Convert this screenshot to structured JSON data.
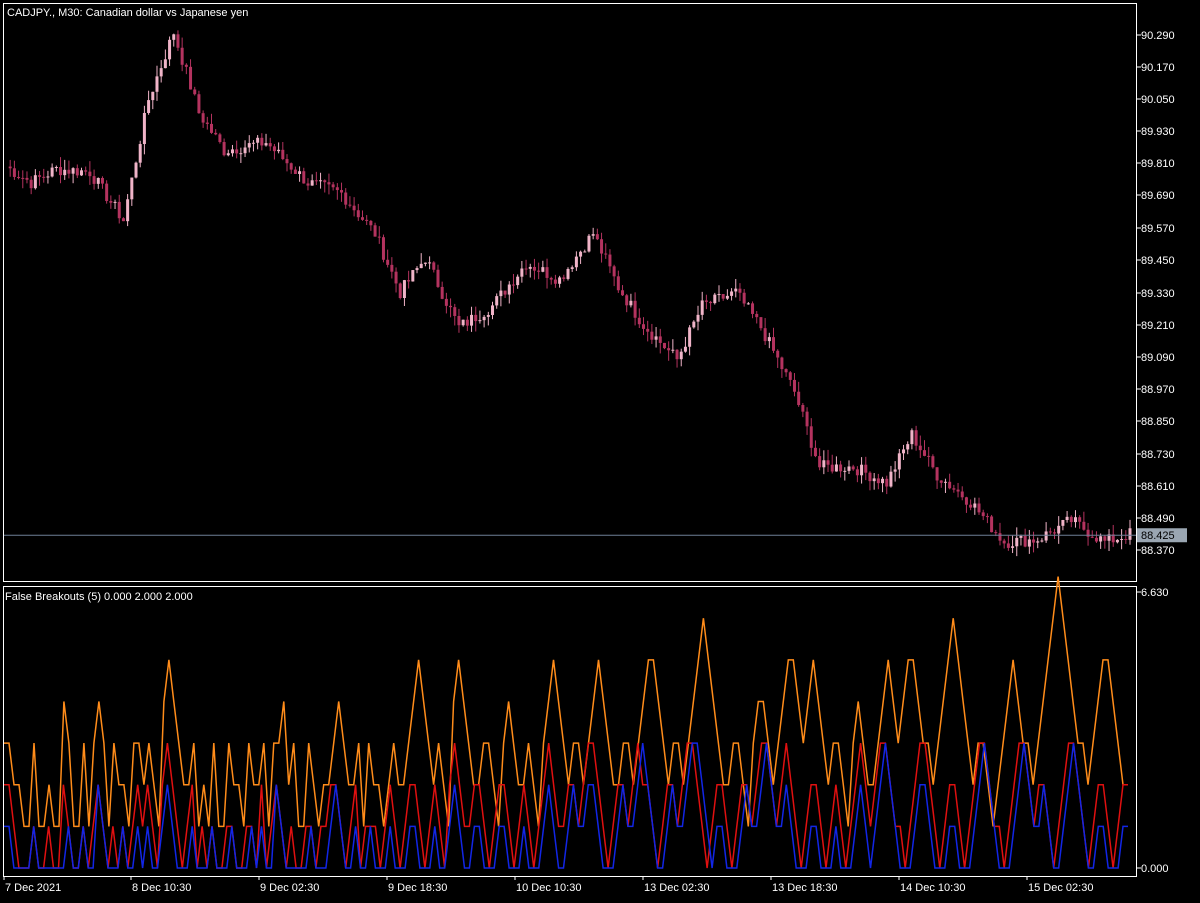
{
  "colors": {
    "background": "#000000",
    "axis": "#ffffff",
    "text": "#ffffff",
    "bear_candle": "#b4335f",
    "bull_candle": "#f0b4c8",
    "current_line": "#6e7f95",
    "line_orange": "#ff8c1a",
    "line_red": "#e01010",
    "line_blue": "#1226e6"
  },
  "price_panel": {
    "title": "CADJPY., M30:  Canadian dollar vs Japanese yen",
    "current_price": "88.425",
    "y_ticks": [
      "90.290",
      "90.170",
      "90.050",
      "89.930",
      "89.810",
      "89.690",
      "89.570",
      "89.450",
      "89.330",
      "89.210",
      "89.090",
      "88.970",
      "88.850",
      "88.730",
      "88.610",
      "88.490",
      "88.370"
    ]
  },
  "indicator_panel": {
    "title": "False Breakouts (5) 0.000 2.000 2.000",
    "y_ticks": [
      "6.630",
      "0.000"
    ]
  },
  "x_ticks": [
    "7 Dec 2021",
    "8 Dec 10:30",
    "9 Dec 02:30",
    "9 Dec 18:30",
    "10 Dec 10:30",
    "13 Dec 02:30",
    "13 Dec 18:30",
    "14 Dec 10:30",
    "15 Dec 02:30"
  ],
  "chart_data": [
    {
      "type": "candlestick",
      "title": "CADJPY., M30:  Canadian dollar vs Japanese yen",
      "ylim": [
        88.33,
        90.35
      ],
      "current_price": 88.425,
      "close_path": [
        [
          0,
          89.8
        ],
        [
          6,
          89.74
        ],
        [
          12,
          89.79
        ],
        [
          20,
          89.78
        ],
        [
          28,
          89.6
        ],
        [
          34,
          90.05
        ],
        [
          40,
          90.3
        ],
        [
          46,
          90.0
        ],
        [
          52,
          89.86
        ],
        [
          62,
          89.89
        ],
        [
          72,
          89.74
        ],
        [
          80,
          89.7
        ],
        [
          88,
          89.55
        ],
        [
          94,
          89.33
        ],
        [
          100,
          89.46
        ],
        [
          108,
          89.2
        ],
        [
          116,
          89.28
        ],
        [
          124,
          89.44
        ],
        [
          132,
          89.38
        ],
        [
          140,
          89.55
        ],
        [
          146,
          89.35
        ],
        [
          152,
          89.21
        ],
        [
          160,
          89.08
        ],
        [
          166,
          89.28
        ],
        [
          174,
          89.33
        ],
        [
          180,
          89.2
        ],
        [
          188,
          88.96
        ],
        [
          194,
          88.68
        ],
        [
          202,
          88.68
        ],
        [
          210,
          88.62
        ],
        [
          216,
          88.8
        ],
        [
          222,
          88.65
        ],
        [
          230,
          88.55
        ],
        [
          238,
          88.4
        ],
        [
          246,
          88.41
        ],
        [
          254,
          88.48
        ],
        [
          262,
          88.4
        ],
        [
          268,
          88.43
        ]
      ]
    },
    {
      "type": "line",
      "title": "False Breakouts (5) 0.000 2.000 2.000",
      "ylim": [
        0,
        6.63
      ],
      "orange_levels": [
        3,
        3,
        2,
        2,
        1,
        1,
        3,
        1,
        1,
        2,
        1,
        1,
        4,
        3,
        1,
        1,
        3,
        1,
        3,
        4,
        3,
        1,
        3,
        2,
        2,
        1,
        3,
        3,
        2,
        3,
        2,
        1,
        4,
        5,
        4,
        3,
        2,
        2,
        3,
        1,
        2,
        1,
        3,
        1,
        1,
        3,
        2,
        2,
        1,
        3,
        2,
        2,
        3,
        1,
        3,
        3,
        4,
        2,
        3,
        1,
        1,
        3,
        2,
        1,
        2,
        2,
        3,
        4,
        3,
        2,
        2,
        3,
        1,
        3,
        2,
        2,
        1,
        2,
        3,
        2,
        2,
        3,
        4,
        5,
        4,
        3,
        2,
        3,
        2,
        1,
        4,
        5,
        4,
        3,
        2,
        2,
        3,
        3,
        2,
        1,
        3,
        4,
        3,
        2,
        2,
        3,
        2,
        1,
        3,
        4,
        5,
        4,
        3,
        2,
        3,
        3,
        2,
        3,
        4,
        5,
        4,
        3,
        2,
        2,
        3,
        3,
        2,
        3,
        4,
        5,
        5,
        4,
        3,
        2,
        3,
        3,
        2,
        3,
        4,
        5,
        6,
        5,
        4,
        3,
        2,
        2,
        3,
        3,
        2,
        1,
        3,
        4,
        4,
        3,
        2,
        3,
        4,
        5,
        5,
        4,
        3,
        4,
        5,
        4,
        3,
        2,
        3,
        3,
        2,
        1,
        3,
        4,
        3,
        2,
        2,
        3,
        4,
        5,
        4,
        3,
        4,
        5,
        5,
        4,
        3,
        3,
        2,
        3,
        4,
        5,
        6,
        5,
        4,
        3,
        2,
        3,
        3,
        2,
        1,
        2,
        3,
        4,
        5,
        4,
        3,
        3,
        2,
        3,
        4,
        5,
        6,
        7,
        6,
        5,
        4,
        3,
        3,
        2,
        3,
        4,
        5,
        5,
        4,
        3,
        2,
        2
      ],
      "red_levels": [
        2,
        2,
        1,
        0,
        0,
        0,
        1,
        0,
        0,
        1,
        0,
        0,
        2,
        1,
        0,
        0,
        1,
        0,
        1,
        2,
        1,
        0,
        1,
        0,
        1,
        0,
        1,
        2,
        1,
        2,
        1,
        0,
        2,
        3,
        2,
        1,
        0,
        1,
        2,
        0,
        1,
        0,
        1,
        0,
        0,
        1,
        1,
        0,
        0,
        1,
        1,
        0,
        2,
        0,
        1,
        2,
        1,
        0,
        1,
        0,
        0,
        1,
        1,
        0,
        1,
        1,
        2,
        2,
        1,
        0,
        1,
        2,
        0,
        1,
        1,
        1,
        0,
        1,
        2,
        1,
        0,
        1,
        2,
        2,
        1,
        0,
        1,
        2,
        1,
        0,
        2,
        3,
        2,
        1,
        1,
        2,
        2,
        1,
        0,
        1,
        2,
        2,
        1,
        0,
        1,
        2,
        1,
        0,
        1,
        2,
        3,
        2,
        1,
        1,
        2,
        2,
        1,
        2,
        3,
        3,
        2,
        1,
        0,
        1,
        2,
        2,
        1,
        2,
        3,
        2,
        2,
        1,
        0,
        1,
        2,
        2,
        1,
        2,
        3,
        3,
        2,
        1,
        0,
        1,
        2,
        2,
        1,
        0,
        1,
        2,
        2,
        1,
        2,
        3,
        3,
        2,
        1,
        2,
        3,
        2,
        1,
        0,
        1,
        2,
        2,
        1,
        0,
        1,
        2,
        1,
        0,
        1,
        2,
        3,
        2,
        1,
        2,
        3,
        3,
        2,
        1,
        1,
        0,
        1,
        2,
        3,
        3,
        2,
        1,
        0,
        1,
        2,
        2,
        1,
        0,
        1,
        2,
        3,
        3,
        2,
        1,
        1,
        0,
        1,
        2,
        3,
        3,
        2,
        1,
        2,
        2,
        1,
        0,
        1,
        2,
        3,
        3,
        2,
        1,
        0,
        1,
        2,
        2,
        1,
        0,
        1,
        2,
        2
      ],
      "blue_levels": [
        1,
        1,
        0,
        0,
        0,
        0,
        1,
        0,
        0,
        0,
        0,
        0,
        0,
        1,
        0,
        0,
        1,
        0,
        0,
        2,
        1,
        0,
        0,
        0,
        1,
        0,
        0,
        1,
        0,
        1,
        0,
        0,
        1,
        2,
        1,
        0,
        0,
        0,
        1,
        0,
        0,
        0,
        1,
        0,
        0,
        0,
        1,
        0,
        0,
        0,
        1,
        0,
        1,
        0,
        0,
        2,
        1,
        0,
        0,
        0,
        0,
        0,
        1,
        0,
        0,
        0,
        1,
        2,
        1,
        0,
        0,
        1,
        0,
        0,
        1,
        0,
        0,
        0,
        1,
        0,
        0,
        0,
        1,
        1,
        0,
        0,
        0,
        1,
        0,
        0,
        1,
        2,
        1,
        0,
        0,
        1,
        1,
        0,
        0,
        0,
        1,
        1,
        0,
        0,
        0,
        1,
        0,
        0,
        0,
        1,
        2,
        1,
        0,
        0,
        1,
        2,
        1,
        1,
        2,
        2,
        1,
        0,
        0,
        0,
        1,
        2,
        1,
        1,
        2,
        3,
        2,
        1,
        0,
        0,
        1,
        2,
        1,
        1,
        2,
        3,
        3,
        2,
        1,
        0,
        1,
        1,
        0,
        0,
        0,
        1,
        2,
        1,
        1,
        2,
        3,
        2,
        1,
        1,
        2,
        1,
        0,
        0,
        0,
        1,
        1,
        0,
        0,
        0,
        1,
        0,
        0,
        0,
        1,
        2,
        1,
        0,
        1,
        2,
        3,
        2,
        1,
        0,
        0,
        0,
        1,
        2,
        2,
        1,
        0,
        0,
        0,
        1,
        1,
        0,
        0,
        0,
        1,
        2,
        3,
        2,
        1,
        0,
        0,
        0,
        1,
        2,
        3,
        2,
        1,
        1,
        2,
        1,
        0,
        0,
        1,
        2,
        3,
        2,
        1,
        0,
        0,
        1,
        1,
        0,
        0,
        0,
        1,
        1
      ]
    }
  ]
}
